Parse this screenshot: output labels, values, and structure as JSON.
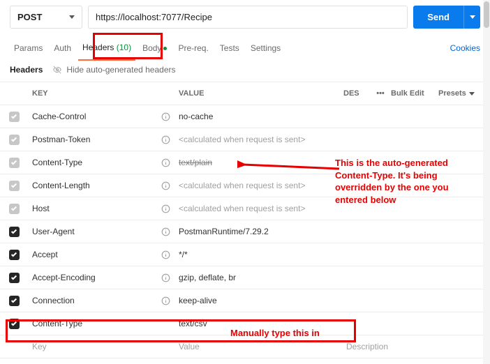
{
  "request": {
    "method": "POST",
    "url": "https://localhost:7077/Recipe",
    "sendLabel": "Send"
  },
  "tabs": {
    "params": "Params",
    "auth": "Auth",
    "headers": "Headers",
    "headersCount": "(10)",
    "body": "Body",
    "prereq": "Pre-req.",
    "tests": "Tests",
    "settings": "Settings",
    "cookies": "Cookies"
  },
  "subbar": {
    "headersLabel": "Headers",
    "hideAuto": "Hide auto-generated headers"
  },
  "table": {
    "head": {
      "key": "KEY",
      "value": "VALUE",
      "desc": "DES",
      "bulk": "Bulk Edit",
      "presets": "Presets"
    },
    "rows": [
      {
        "key": "Cache-Control",
        "value": "no-cache",
        "info": true,
        "light": true
      },
      {
        "key": "Postman-Token",
        "value": "<calculated when request is sent>",
        "info": true,
        "light": true
      },
      {
        "key": "Content-Type",
        "value": "text/plain",
        "strike": true,
        "info": true,
        "light": true
      },
      {
        "key": "Content-Length",
        "value": "<calculated when request is sent>",
        "info": true,
        "light": true
      },
      {
        "key": "Host",
        "value": "<calculated when request is sent>",
        "info": true,
        "light": true
      },
      {
        "key": "User-Agent",
        "value": "PostmanRuntime/7.29.2",
        "info": true
      },
      {
        "key": "Accept",
        "value": "*/*",
        "info": true
      },
      {
        "key": "Accept-Encoding",
        "value": "gzip, deflate, br",
        "info": true
      },
      {
        "key": "Connection",
        "value": "keep-alive",
        "info": true
      },
      {
        "key": "Content-Type",
        "value": "text/csv",
        "info": false
      }
    ],
    "placeholder": {
      "key": "Key",
      "value": "Value",
      "desc": "Description"
    }
  },
  "annotations": {
    "a1_l1": "This is the auto-generated",
    "a1_l2": "Content-Type. It's being",
    "a1_l3": "overridden by the one you",
    "a1_l4": "entered below",
    "a2": "Manually type this in"
  }
}
